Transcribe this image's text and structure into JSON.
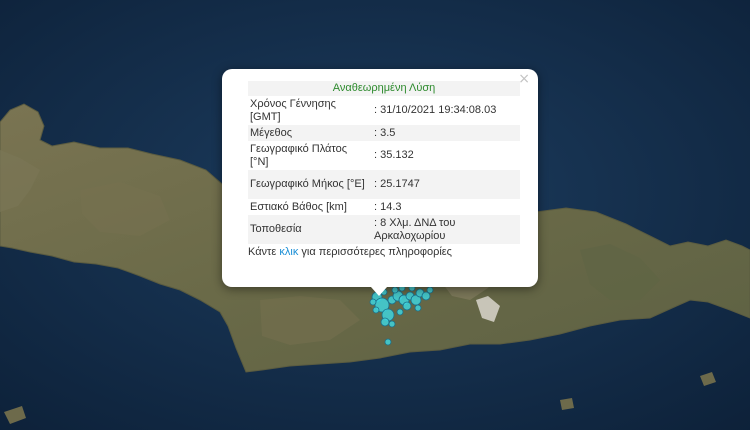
{
  "popup": {
    "close_label": "×",
    "title": "Αναθεωρημένη Λύση",
    "rows": [
      {
        "label": "Χρόνος Γέννησης [GMT]",
        "value": ": 31/10/2021 19:34:08.03"
      },
      {
        "label": "Μέγεθος",
        "value": ": 3.5"
      },
      {
        "label": "Γεωγραφικό Πλάτος [°N]",
        "value": ": 35.132"
      },
      {
        "label": "Γεωγραφικό Μήκος [°E]",
        "value": ": 25.1747"
      },
      {
        "label": "Εστιακό Βάθος [km]",
        "value": ": 14.3"
      },
      {
        "label": "Τοποθεσία",
        "value": ": 8 Χλμ. ΔΝΔ του Αρκαλοχωρίου"
      }
    ],
    "more_before": "Κάντε ",
    "more_link": "κλικ",
    "more_after": " για περισσότερες πληροφορίες"
  },
  "map": {
    "sea_color": "#15304f",
    "land_color": "#6b6a4a",
    "marker_color": "#3fd3dc",
    "marker_stroke": "#1b6f8a"
  }
}
